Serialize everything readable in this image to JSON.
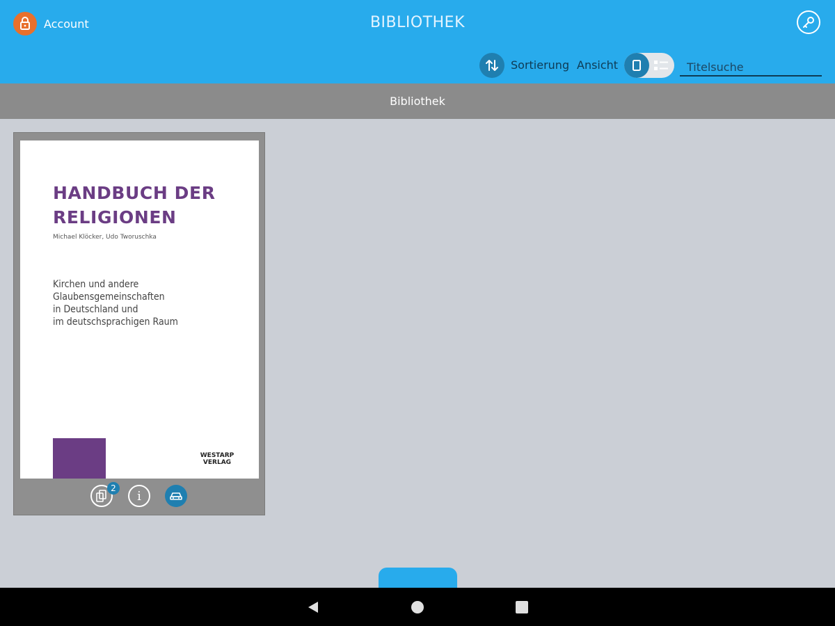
{
  "header": {
    "account_label": "Account",
    "title": "BIBLIOTHEK",
    "account_icon": "lock-icon",
    "key_icon": "key-icon"
  },
  "toolbar": {
    "sort_label": "Sortierung",
    "view_label": "Ansicht",
    "search_placeholder": "Titelsuche",
    "search_value": "",
    "view_mode": "grid"
  },
  "section": {
    "title": "Bibliothek"
  },
  "books": [
    {
      "title": "HANDBUCH DER RELIGIONEN",
      "authors": "Michael Klöcker, Udo Tworuschka",
      "subtitle_lines": [
        "Kirchen und andere",
        "Glaubensgemeinschaften",
        "in Deutschland und",
        "im deutschsprachigen Raum"
      ],
      "publisher_lines": [
        "WESTARP",
        "VERLAG"
      ],
      "copies_count": "2",
      "actions": [
        "copies-icon",
        "info-icon",
        "car-icon"
      ]
    }
  ],
  "colors": {
    "header_bg": "#28abec",
    "accent_dark": "#1f7fb0",
    "account_orange": "#e8702c",
    "section_bar": "#8b8b8b",
    "content_bg": "#cbcfd6",
    "cover_purple": "#6b3d84"
  },
  "navigation": {
    "back_icon": "back-triangle-icon",
    "home_icon": "home-circle-icon",
    "recents_icon": "recents-square-icon"
  }
}
